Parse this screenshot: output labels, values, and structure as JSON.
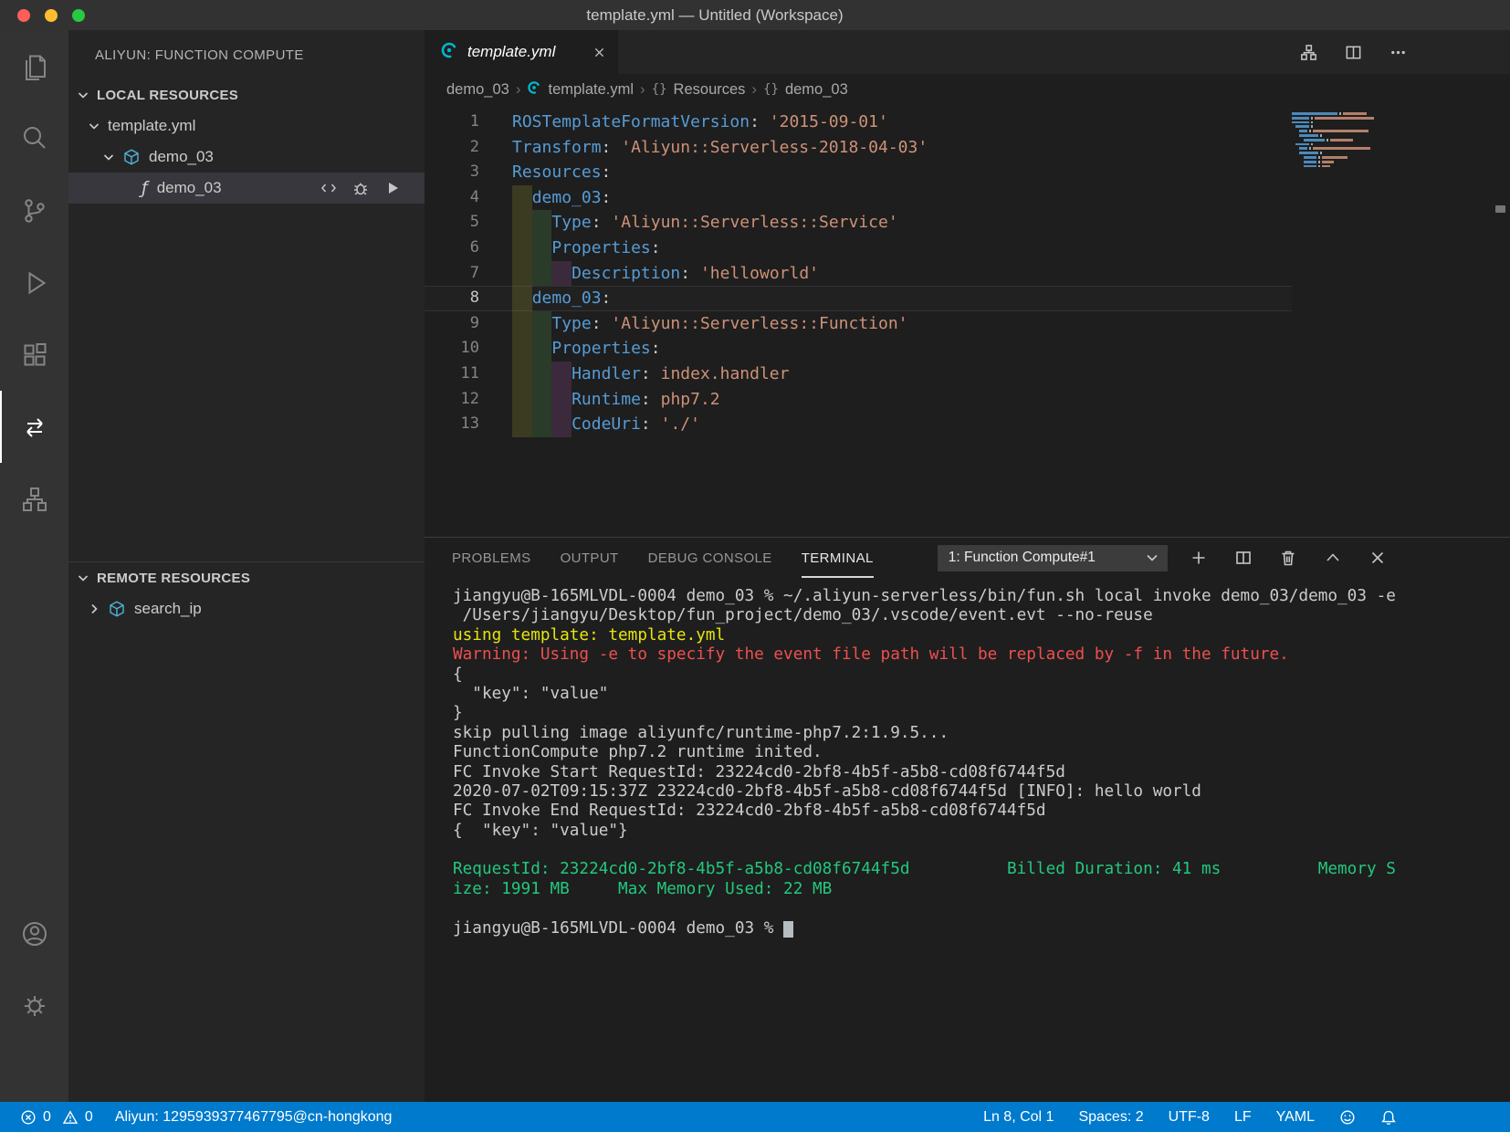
{
  "window": {
    "title": "template.yml — Untitled (Workspace)"
  },
  "icons": {
    "breadcrumb_separator": "›",
    "object_symbol": "{}",
    "function_glyph": "ƒ"
  },
  "colors": {
    "accent": "#007acc",
    "titlebar": "#323233",
    "activity_bar": "#333333",
    "sidebar": "#252526",
    "editor": "#1e1e1e",
    "selected_row": "#37373d",
    "yaml_key": "#569cd6",
    "yaml_string": "#ce9178",
    "ansi_yellow": "#e5e510",
    "ansi_red": "#ef4f4f",
    "ansi_green": "#23c87d",
    "aliyun_teal": "#00b8cc",
    "traffic_red": "#ff5f57",
    "traffic_yellow": "#febc2e",
    "traffic_green": "#28c840"
  },
  "sidebar": {
    "title": "ALIYUN: FUNCTION COMPUTE",
    "local": {
      "header": "LOCAL RESOURCES",
      "template_label": "template.yml",
      "service_label": "demo_03",
      "function_label": "demo_03"
    },
    "remote": {
      "header": "REMOTE RESOURCES",
      "service_label": "search_ip"
    }
  },
  "editor": {
    "tab": {
      "label": "template.yml"
    },
    "breadcrumbs": {
      "folder": "demo_03",
      "file": "template.yml",
      "symbol1": "Resources",
      "symbol2": "demo_03"
    },
    "indent_colors": [
      "rgba(255,255,64,0.13)",
      "rgba(127,255,127,0.13)",
      "rgba(255,127,255,0.13)",
      "rgba(79,236,236,0.13)"
    ],
    "lines": [
      {
        "n": 1,
        "indent": 0,
        "tokens": [
          [
            "k",
            "ROSTemplateFormatVersion"
          ],
          [
            "p",
            ":"
          ],
          [
            "s",
            " '2015-09-01'"
          ]
        ]
      },
      {
        "n": 2,
        "indent": 0,
        "tokens": [
          [
            "k",
            "Transform"
          ],
          [
            "p",
            ":"
          ],
          [
            "s",
            " 'Aliyun::Serverless-2018-04-03'"
          ]
        ]
      },
      {
        "n": 3,
        "indent": 0,
        "tokens": [
          [
            "k",
            "Resources"
          ],
          [
            "p",
            ":"
          ]
        ]
      },
      {
        "n": 4,
        "indent": 1,
        "tokens": [
          [
            "k",
            "demo_03"
          ],
          [
            "p",
            ":"
          ]
        ]
      },
      {
        "n": 5,
        "indent": 2,
        "tokens": [
          [
            "k",
            "Type"
          ],
          [
            "p",
            ":"
          ],
          [
            "s",
            " 'Aliyun::Serverless::Service'"
          ]
        ]
      },
      {
        "n": 6,
        "indent": 2,
        "tokens": [
          [
            "k",
            "Properties"
          ],
          [
            "p",
            ":"
          ]
        ]
      },
      {
        "n": 7,
        "indent": 3,
        "tokens": [
          [
            "k",
            "Description"
          ],
          [
            "p",
            ":"
          ],
          [
            "s",
            " 'helloworld'"
          ]
        ]
      },
      {
        "n": 8,
        "indent": 1,
        "current": true,
        "tokens": [
          [
            "k",
            "demo_03"
          ],
          [
            "p",
            ":"
          ]
        ]
      },
      {
        "n": 9,
        "indent": 2,
        "tokens": [
          [
            "k",
            "Type"
          ],
          [
            "p",
            ":"
          ],
          [
            "s",
            " 'Aliyun::Serverless::Function'"
          ]
        ]
      },
      {
        "n": 10,
        "indent": 2,
        "tokens": [
          [
            "k",
            "Properties"
          ],
          [
            "p",
            ":"
          ]
        ]
      },
      {
        "n": 11,
        "indent": 3,
        "tokens": [
          [
            "k",
            "Handler"
          ],
          [
            "p",
            ":"
          ],
          [
            "s",
            " index.handler"
          ]
        ]
      },
      {
        "n": 12,
        "indent": 3,
        "tokens": [
          [
            "k",
            "Runtime"
          ],
          [
            "p",
            ":"
          ],
          [
            "s",
            " php7.2"
          ]
        ]
      },
      {
        "n": 13,
        "indent": 3,
        "tokens": [
          [
            "k",
            "CodeUri"
          ],
          [
            "p",
            ":"
          ],
          [
            "s",
            " './'"
          ]
        ]
      }
    ]
  },
  "panel": {
    "tabs": [
      {
        "label": "PROBLEMS"
      },
      {
        "label": "OUTPUT"
      },
      {
        "label": "DEBUG CONSOLE"
      },
      {
        "label": "TERMINAL"
      }
    ],
    "terminal": {
      "select_label": "1: Function Compute#1",
      "lines": [
        {
          "c": "fg",
          "t": "jiangyu@B-165MLVDL-0004 demo_03 % ~/.aliyun-serverless/bin/fun.sh local invoke demo_03/demo_03 -e"
        },
        {
          "c": "fg",
          "t": " /Users/jiangyu/Desktop/fun_project/demo_03/.vscode/event.evt --no-reuse"
        },
        {
          "c": "yellow",
          "t": "using template: template.yml"
        },
        {
          "c": "red",
          "t": "Warning: Using -e to specify the event file path will be replaced by -f in the future."
        },
        {
          "c": "fg",
          "t": "{"
        },
        {
          "c": "fg",
          "t": "  \"key\": \"value\""
        },
        {
          "c": "fg",
          "t": "}"
        },
        {
          "c": "fg",
          "t": "skip pulling image aliyunfc/runtime-php7.2:1.9.5..."
        },
        {
          "c": "fg",
          "t": "FunctionCompute php7.2 runtime inited."
        },
        {
          "c": "fg",
          "t": "FC Invoke Start RequestId: 23224cd0-2bf8-4b5f-a5b8-cd08f6744f5d"
        },
        {
          "c": "fg",
          "t": "2020-07-02T09:15:37Z 23224cd0-2bf8-4b5f-a5b8-cd08f6744f5d [INFO]: hello world"
        },
        {
          "c": "fg",
          "t": "FC Invoke End RequestId: 23224cd0-2bf8-4b5f-a5b8-cd08f6744f5d"
        },
        {
          "c": "fg",
          "t": "{  \"key\": \"value\"}"
        },
        {
          "c": "fg",
          "t": ""
        },
        {
          "c": "green",
          "t": "RequestId: 23224cd0-2bf8-4b5f-a5b8-cd08f6744f5d          Billed Duration: 41 ms          Memory S"
        },
        {
          "c": "green",
          "t": "ize: 1991 MB     Max Memory Used: 22 MB"
        },
        {
          "c": "fg",
          "t": ""
        },
        {
          "c": "fg",
          "t": "jiangyu@B-165MLVDL-0004 demo_03 % ",
          "cursor": true
        }
      ]
    }
  },
  "status_bar": {
    "errors": "0",
    "warnings": "0",
    "account": "Aliyun: 1295939377467795@cn-hongkong",
    "cursor": "Ln 8, Col 1",
    "indentation": "Spaces: 2",
    "encoding": "UTF-8",
    "eol": "LF",
    "language": "YAML"
  }
}
